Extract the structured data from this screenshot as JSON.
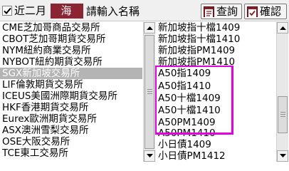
{
  "topbar": {
    "checkbox_label": "近二月",
    "checkbox_checked": true,
    "overseas_tab": "海 外",
    "search_placeholder": "請輸入名稱",
    "query_button": "查詢",
    "confirm_button": "確認"
  },
  "exchanges": [
    "CME芝加哥商品交易所",
    "CBOT芝加哥期貨交易所",
    "NYM紐約商業交易所",
    "NYBOT紐約期貨交易所",
    "SGX新加坡交易所",
    "LIF倫敦期貨交易所",
    "ICEUS美國洲際期貨交易所",
    "HKF香港期貨交易所",
    "Eurex歐洲期貨交易所",
    "ASX澳洲雪梨交易所",
    "OSE大阪交易所",
    "TCE東工交易所"
  ],
  "selected_exchange": "SGX新加坡交易所",
  "products": [
    "新加坡指十檔1409",
    "新加坡指十檔1410",
    "新加坡指PM1409",
    "新加坡指PM1410",
    "A50指1409",
    "A50指1410",
    "A50十檔1409",
    "A50十檔1410",
    "A50PM1409",
    "A50PM1410",
    "小日債1409",
    "小日債PM1412"
  ],
  "colors": {
    "accent": "#8b2533",
    "selection": "#b4b4b4",
    "annotation": "#e000e0"
  }
}
